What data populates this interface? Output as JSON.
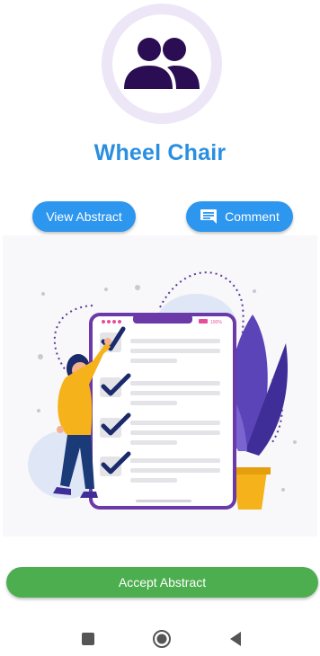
{
  "header": {
    "title": "Wheel Chair",
    "avatar_icon": "group-icon"
  },
  "actions": {
    "view_abstract_label": "View Abstract",
    "comment_label": "Comment",
    "comment_icon": "comment-icon",
    "accept_label": "Accept Abstract"
  },
  "illustration": {
    "subject": "checklist-illustration",
    "status_percent_text": "100%"
  },
  "navbar": {
    "items": [
      "recents-icon",
      "home-icon",
      "back-icon"
    ]
  },
  "colors": {
    "accent_blue": "#2d96ee",
    "title_blue": "#2a8fe0",
    "accept_green": "#4cae4f",
    "avatar_purple": "#2a0d52"
  }
}
